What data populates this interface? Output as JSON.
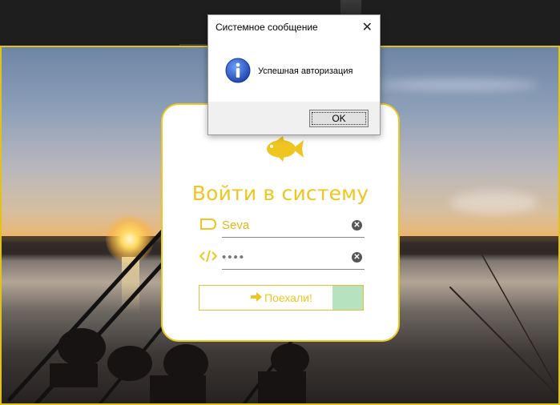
{
  "login": {
    "title": "Войти в систему",
    "username": "Seva",
    "password_masked": "••••",
    "submit_label": "Поехали!",
    "clear_glyph": "✕",
    "accent": "#f0c520",
    "submit_fill": "#b7e2bf",
    "icons": {
      "logo": "fish-icon",
      "username": "tag-icon",
      "password": "code-icon",
      "submit": "arrow-right-icon",
      "clear": "clear-icon"
    }
  },
  "dialog": {
    "title": "Системное сообщение",
    "close_glyph": "✕",
    "message": "Успешная авторизация",
    "ok_label": "OK",
    "icon": "info-icon"
  },
  "background": {
    "frame_color": "#e0c21a",
    "description_icon": "sunset-lake-photo"
  }
}
